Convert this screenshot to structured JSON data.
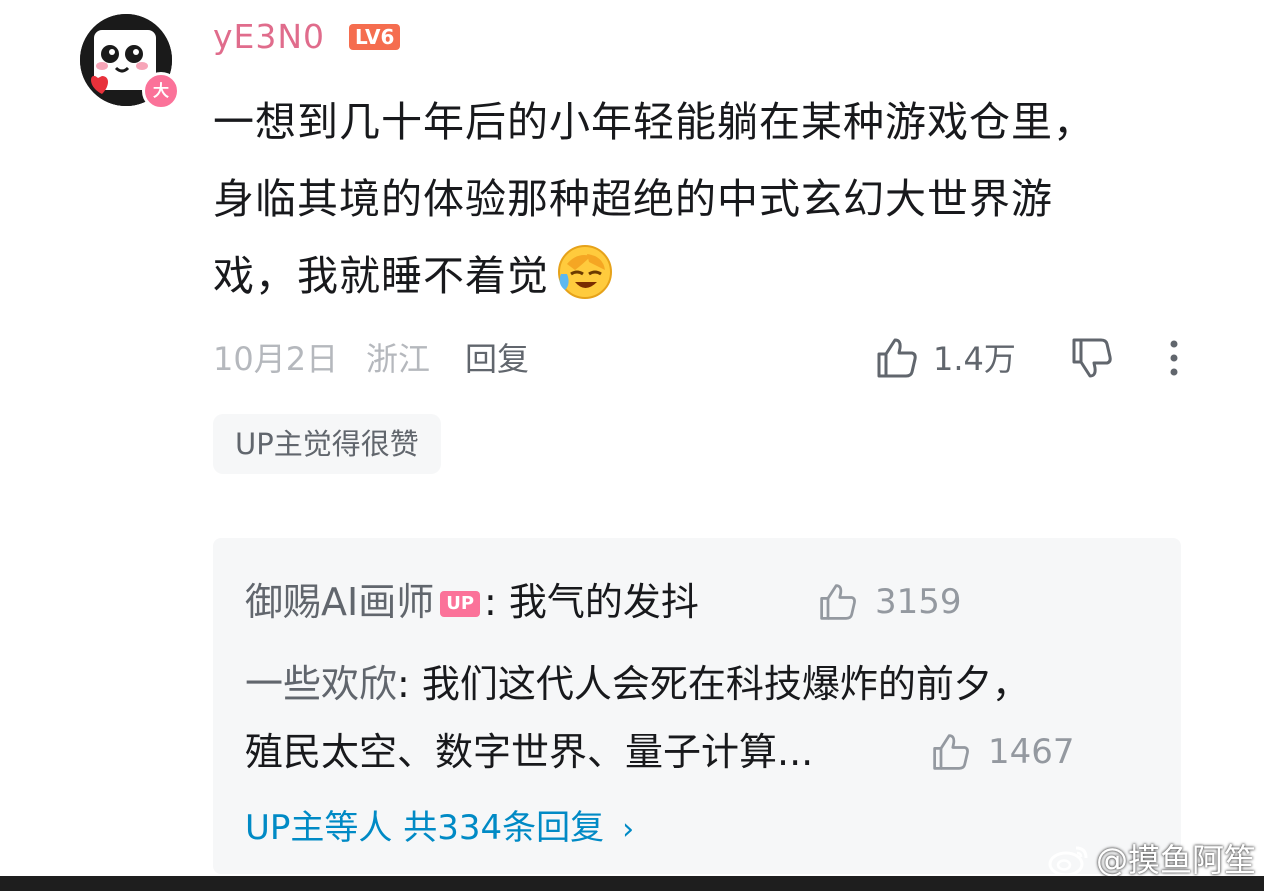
{
  "comment": {
    "avatar_icon": "panda-avatar",
    "vip_badge": "大",
    "username": "yE3N0",
    "level": "LV6",
    "text_lines": [
      "一想到几十年后的小年轻能躺在某种游戏仓里，",
      "身临其境的体验那种超绝的中式玄幻大世界游",
      "戏，我就睡不着觉"
    ],
    "emoji_icon": "crying-face-emoji",
    "date": "10月2日",
    "location": "浙江",
    "reply_label": "回复",
    "like_count": "1.4万",
    "up_liked_tag": "UP主觉得很赞"
  },
  "replies": [
    {
      "name": "御赐AI画师",
      "badge": "UP",
      "text": "我气的发抖",
      "likes": "3159"
    },
    {
      "name": "一些欢欣",
      "text_line1": "我们这代人会死在科技爆炸的前夕，",
      "text_line2": "殖民太空、数字世界、量子计算...",
      "likes": "1467"
    }
  ],
  "more_replies": "UP主等人 共334条回复",
  "more_replies_chevron": "›",
  "watermark": {
    "icon": "weibo-logo-icon",
    "text": "@摸鱼阿笙"
  },
  "colors": {
    "username": "#e06c8c",
    "level_badge": "#f56d4f",
    "up_badge": "#fb7299",
    "link": "#008ac5"
  }
}
